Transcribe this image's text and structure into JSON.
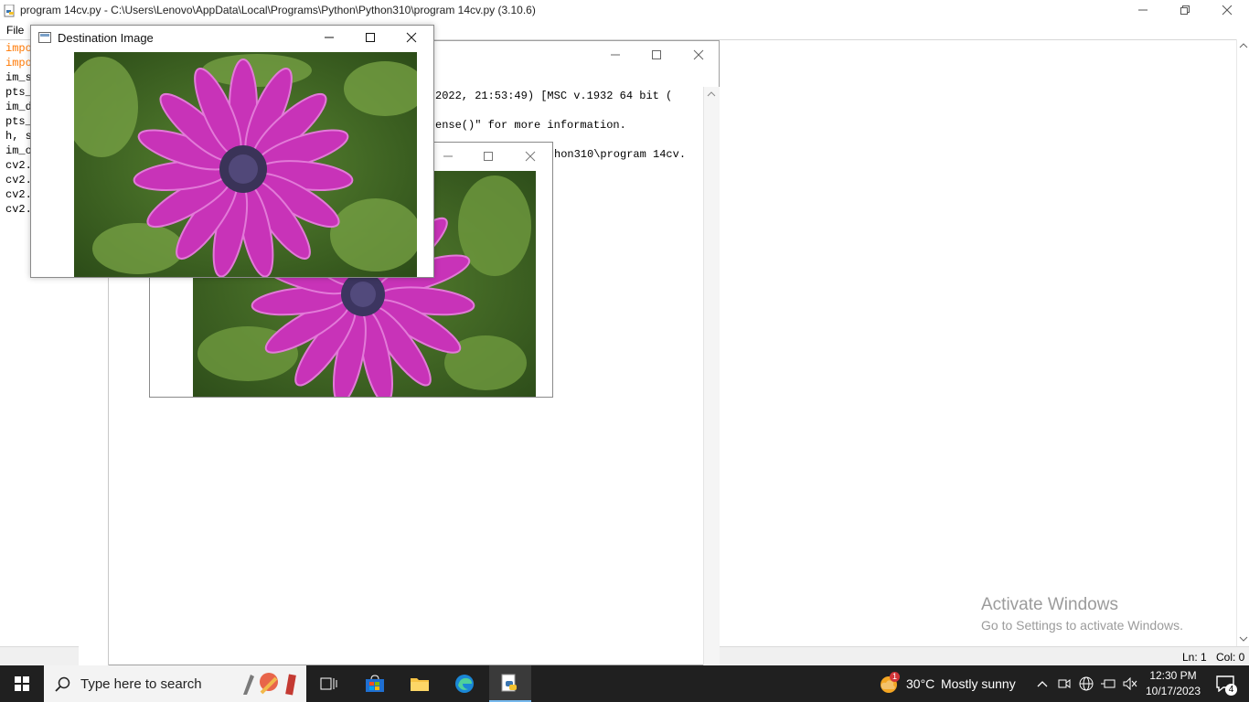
{
  "editor": {
    "title": "program 14cv.py - C:\\Users\\Lenovo\\AppData\\Local\\Programs\\Python\\Python310\\program 14cv.py (3.10.6)",
    "menu": [
      "File"
    ],
    "code_lines": [
      {
        "text": "impo",
        "color": "#ff7700"
      },
      {
        "text": "impo",
        "color": "#ff7700"
      },
      {
        "text": "im_s",
        "color": "#000000"
      },
      {
        "text": "pts_",
        "color": "#000000"
      },
      {
        "text": "im_d",
        "color": "#000000"
      },
      {
        "text": "pts_",
        "color": "#000000"
      },
      {
        "text": "h, s",
        "color": "#000000"
      },
      {
        "text": "im_o",
        "color": "#000000"
      },
      {
        "text": "cv2.",
        "color": "#000000"
      },
      {
        "text": "cv2.",
        "color": "#000000"
      },
      {
        "text": "cv2.",
        "color": "#000000"
      },
      {
        "text": "cv2.",
        "color": "#000000"
      }
    ],
    "status": {
      "line": "Ln: 1",
      "col": "Col: 0"
    }
  },
  "shell": {
    "lines": [
      "2022, 21:53:49) [MSC v.1932 64 bit (",
      "ense()\" for more information.",
      "hon310\\program 14cv."
    ]
  },
  "destination_window": {
    "title": "Destination Image"
  },
  "watermark": {
    "title": "Activate Windows",
    "subtitle": "Go to Settings to activate Windows."
  },
  "taskbar": {
    "search_placeholder": "Type here to search",
    "weather": {
      "temp": "30°C",
      "condition": "Mostly sunny",
      "badge": "1"
    },
    "time": "12:30 PM",
    "date": "10/17/2023",
    "notifications": "4"
  },
  "colors": {
    "keyword": "#ff7700",
    "taskbar": "#202020",
    "accent": "#0078d7"
  }
}
